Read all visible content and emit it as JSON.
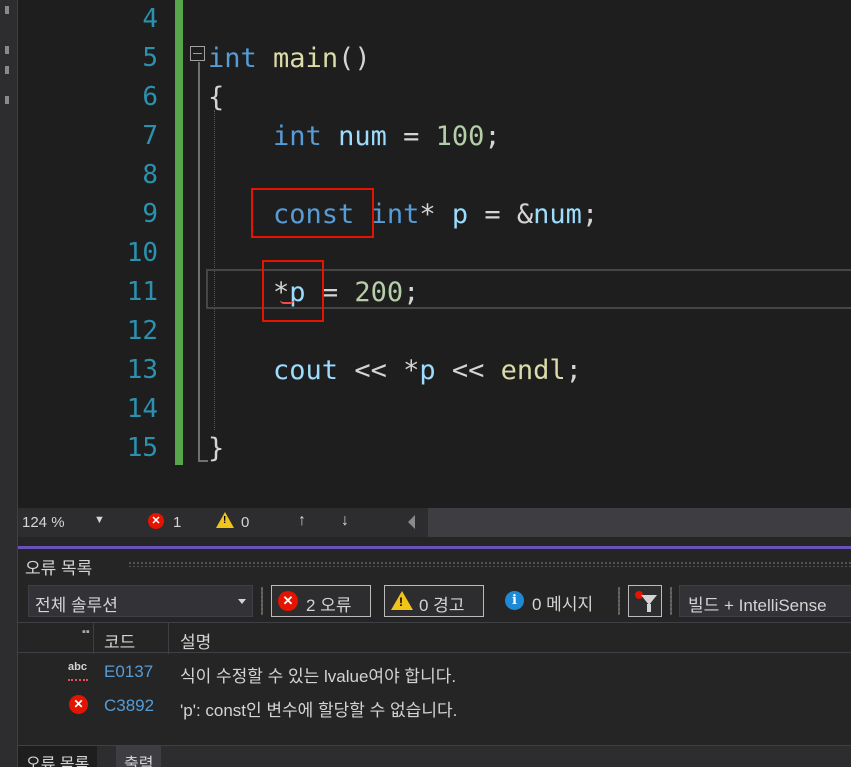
{
  "editor": {
    "line_numbers": [
      "4",
      "5",
      "6",
      "7",
      "8",
      "9",
      "10",
      "11",
      "12",
      "13",
      "14",
      "15"
    ],
    "lines": [
      {
        "line": "4",
        "tokens": []
      },
      {
        "line": "5",
        "tokens": [
          {
            "t": "int",
            "c": "kw"
          },
          {
            "t": " ",
            "c": "pl"
          },
          {
            "t": "main",
            "c": "fn"
          },
          {
            "t": "()",
            "c": "pl"
          }
        ]
      },
      {
        "line": "6",
        "tokens": [
          {
            "t": "{",
            "c": "pl"
          }
        ]
      },
      {
        "line": "7",
        "tokens": [
          {
            "t": "    ",
            "c": "pl"
          },
          {
            "t": "int",
            "c": "kw"
          },
          {
            "t": " ",
            "c": "pl"
          },
          {
            "t": "num",
            "c": "var"
          },
          {
            "t": " = ",
            "c": "pl"
          },
          {
            "t": "100",
            "c": "num"
          },
          {
            "t": ";",
            "c": "pl"
          }
        ]
      },
      {
        "line": "8",
        "tokens": []
      },
      {
        "line": "9",
        "tokens": [
          {
            "t": "    ",
            "c": "pl"
          },
          {
            "t": "const",
            "c": "kw"
          },
          {
            "t": " ",
            "c": "pl"
          },
          {
            "t": "int",
            "c": "kw"
          },
          {
            "t": "* ",
            "c": "pl"
          },
          {
            "t": "p",
            "c": "var"
          },
          {
            "t": " = &",
            "c": "pl"
          },
          {
            "t": "num",
            "c": "var"
          },
          {
            "t": ";",
            "c": "pl"
          }
        ]
      },
      {
        "line": "10",
        "tokens": []
      },
      {
        "line": "11",
        "tokens": [
          {
            "t": "    ",
            "c": "pl"
          },
          {
            "t": "*",
            "c": "pl"
          },
          {
            "t": "p",
            "c": "var"
          },
          {
            "t": " = ",
            "c": "pl"
          },
          {
            "t": "200",
            "c": "num"
          },
          {
            "t": ";",
            "c": "pl"
          }
        ]
      },
      {
        "line": "12",
        "tokens": []
      },
      {
        "line": "13",
        "tokens": [
          {
            "t": "    ",
            "c": "pl"
          },
          {
            "t": "cout",
            "c": "var"
          },
          {
            "t": " << *",
            "c": "pl"
          },
          {
            "t": "p",
            "c": "var"
          },
          {
            "t": " << ",
            "c": "pl"
          },
          {
            "t": "endl",
            "c": "fn"
          },
          {
            "t": ";",
            "c": "pl"
          }
        ]
      },
      {
        "line": "14",
        "tokens": []
      },
      {
        "line": "15",
        "tokens": [
          {
            "t": "}",
            "c": "pl"
          }
        ]
      }
    ],
    "colors": {
      "keyword": "#569cd6",
      "function": "#dcdcaa",
      "variable": "#9cdcfe",
      "number": "#b5cea8",
      "line_number": "#2b91af",
      "highlight_box": "#e51400",
      "change_bar": "#57a64a"
    }
  },
  "status_bar": {
    "zoom": "124 %",
    "zoom_dropdown_icon": "caret-down-icon",
    "error_count": "1",
    "warning_count": "0",
    "prev_icon": "arrow-up-icon",
    "next_icon": "arrow-down-icon"
  },
  "error_list": {
    "title": "오류 목록",
    "scope": "전체 솔루션",
    "errors_label": "2 오류",
    "warnings_label": "0 경고",
    "messages_label": "0 메시지",
    "build_filter": "빌드 + IntelliSense",
    "columns": {
      "code": "코드",
      "description": "설명"
    },
    "rows": [
      {
        "icon": "intellisense-abc-icon",
        "code": "E0137",
        "description": "식이 수정할 수 있는 lvalue여야 합니다."
      },
      {
        "icon": "error-icon",
        "code": "C3892",
        "description": "'p': const인 변수에 할당할 수 없습니다."
      }
    ]
  },
  "bottom_tabs": [
    "오류 목록",
    "출력"
  ]
}
